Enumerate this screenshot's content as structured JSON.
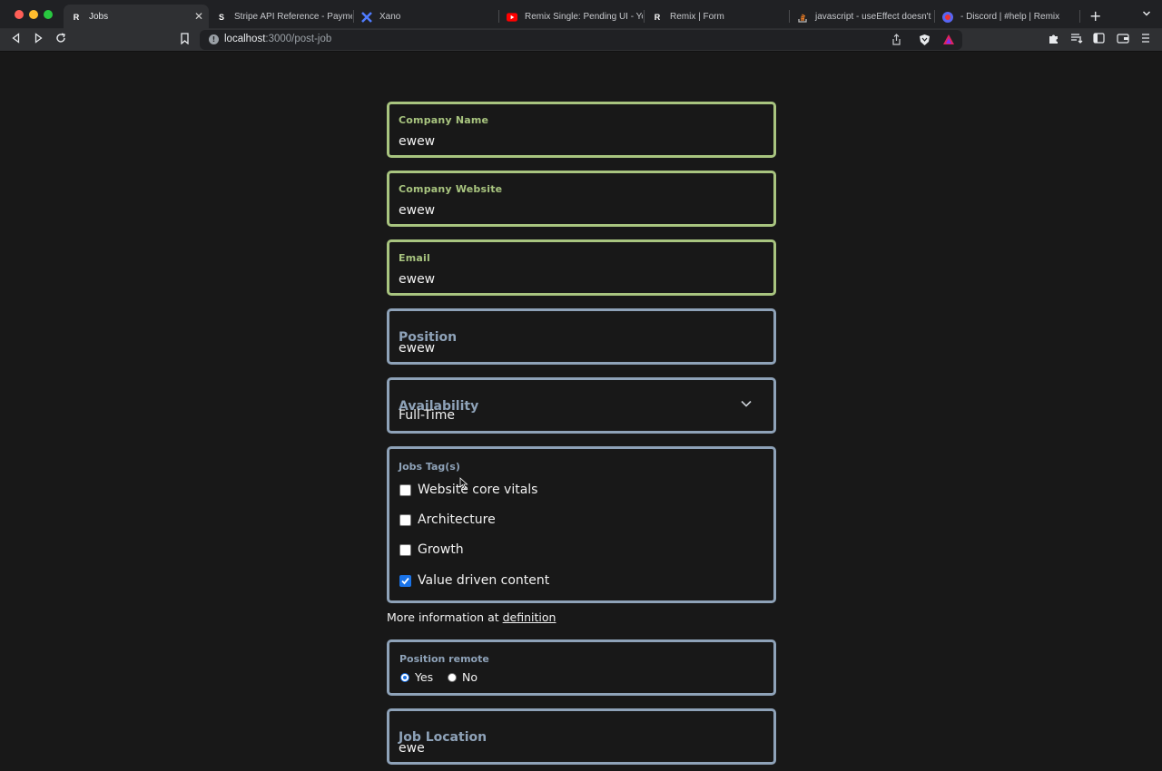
{
  "browser": {
    "tabs": [
      {
        "label": "Jobs",
        "icon": "remix-icon",
        "active": true
      },
      {
        "label": "Stripe API Reference - Payme",
        "icon": "stripe-icon"
      },
      {
        "label": "Xano",
        "icon": "xano-icon"
      },
      {
        "label": "Remix Single: Pending UI - Yo",
        "icon": "youtube-icon"
      },
      {
        "label": "Remix | Form",
        "icon": "remix-icon"
      },
      {
        "label": "javascript - useEffect doesn't",
        "icon": "stackoverflow-icon"
      },
      {
        "label": "- Discord | #help | Remix",
        "icon": "discord-icon"
      }
    ],
    "url_host": "localhost",
    "url_path": ":3000/post-job"
  },
  "form": {
    "company_name": {
      "label": "Company Name",
      "value": "ewew"
    },
    "company_website": {
      "label": "Company Website",
      "value": "ewew"
    },
    "email": {
      "label": "Email",
      "value": "ewew"
    },
    "position": {
      "label": "Position",
      "value": "ewew"
    },
    "availability": {
      "label": "Availability",
      "value": "Full-Time"
    },
    "tags": {
      "label": "Jobs Tag(s)",
      "options": [
        {
          "label": "Website core vitals",
          "checked": false
        },
        {
          "label": "Architecture",
          "checked": false
        },
        {
          "label": "Growth",
          "checked": false
        },
        {
          "label": "Value driven content",
          "checked": true
        }
      ]
    },
    "more_info": {
      "prefix": "More information at",
      "link": "definition"
    },
    "remote": {
      "label": "Position remote",
      "options": [
        {
          "label": "Yes",
          "selected": true
        },
        {
          "label": "No",
          "selected": false
        }
      ]
    },
    "job_location": {
      "label": "Job Location",
      "value": "ewe"
    }
  },
  "colors": {
    "valid_border": "#a8c47f",
    "default_border": "#8ea2b8",
    "background": "#181818"
  }
}
